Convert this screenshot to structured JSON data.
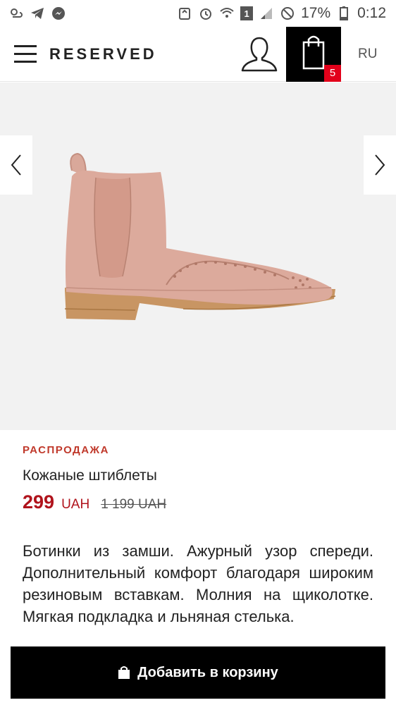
{
  "status_bar": {
    "battery": "17%",
    "time": "0:12",
    "sim": "1"
  },
  "header": {
    "logo": "RESERVED",
    "bag_count": "5",
    "language": "RU"
  },
  "product": {
    "sale_label": "РАСПРОДАЖА",
    "name": "Кожаные штиблеты",
    "price": "299",
    "currency": "UAH",
    "old_price": "1 199 UAH",
    "description": "Ботинки из замши. Ажурный узор спереди. Дополнительный комфорт благодаря широким резиновым вставкам. Молния на щиколотке. Мягкая подкладка и льняная стелька."
  },
  "actions": {
    "add_to_cart": "Добавить в корзину"
  },
  "colors": {
    "accent_red": "#b0131c",
    "sale_red": "#c0392b",
    "badge_red": "#e2001a",
    "boot": "#d9a89a"
  }
}
